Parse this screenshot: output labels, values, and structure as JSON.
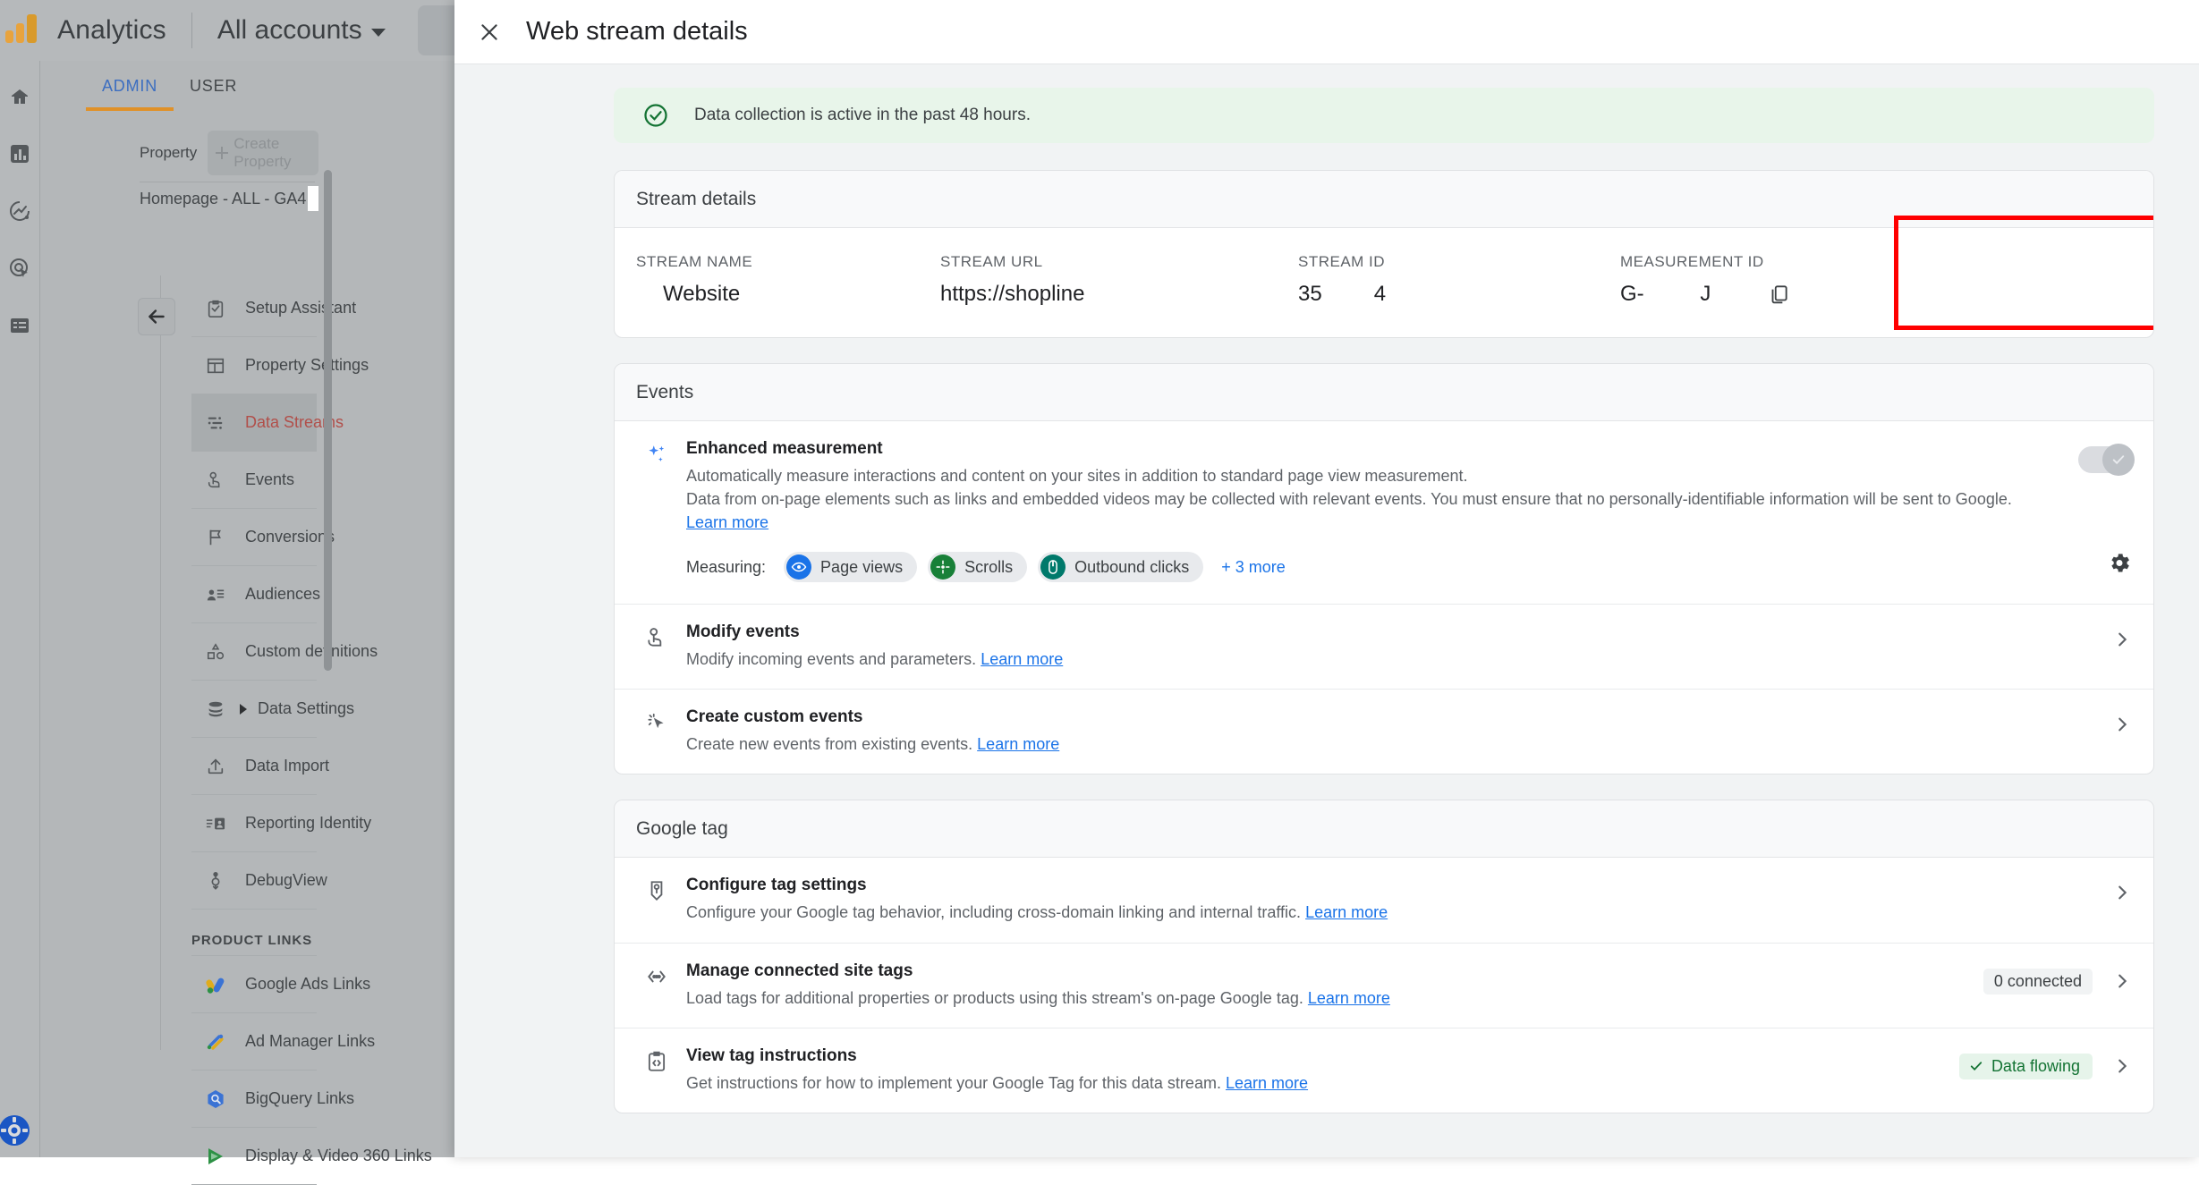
{
  "topbar": {
    "product_name": "Analytics",
    "account_selector": "All accounts",
    "search_icon": "search-icon"
  },
  "rail": {
    "icons": [
      "home-icon",
      "reports-bar-chart-icon",
      "explore-trend-icon",
      "advertising-target-icon",
      "configure-list-icon",
      "gear-icon"
    ]
  },
  "admin": {
    "tabs": [
      {
        "label": "ADMIN",
        "active": true
      },
      {
        "label": "USER",
        "active": false
      }
    ],
    "property_label": "Property",
    "create_property_label": "Create Property",
    "property_name": "Homepage - ALL - GA4",
    "collapse_icon": "arrow-left-icon",
    "nav_items": [
      {
        "label": "Setup Assistant",
        "icon": "clipboard-check-icon",
        "selected": false,
        "expandable": false
      },
      {
        "label": "Property Settings",
        "icon": "layout-panel-icon",
        "selected": false,
        "expandable": false
      },
      {
        "label": "Data Streams",
        "icon": "data-streams-icon",
        "selected": true,
        "expandable": false
      },
      {
        "label": "Events",
        "icon": "tap-hand-icon",
        "selected": false,
        "expandable": false
      },
      {
        "label": "Conversions",
        "icon": "flag-icon",
        "selected": false,
        "expandable": false
      },
      {
        "label": "Audiences",
        "icon": "audiences-person-list-icon",
        "selected": false,
        "expandable": false
      },
      {
        "label": "Custom definitions",
        "icon": "shapes-icon",
        "selected": false,
        "expandable": false
      },
      {
        "label": "Data Settings",
        "icon": "database-icon",
        "selected": false,
        "expandable": true
      },
      {
        "label": "Data Import",
        "icon": "upload-icon",
        "selected": false,
        "expandable": false
      },
      {
        "label": "Reporting Identity",
        "icon": "reporting-identity-badge-icon",
        "selected": false,
        "expandable": false
      },
      {
        "label": "DebugView",
        "icon": "debug-probe-icon",
        "selected": false,
        "expandable": false
      }
    ],
    "product_links_header": "PRODUCT LINKS",
    "product_links": [
      {
        "label": "Google Ads Links",
        "icon": "google-ads-icon"
      },
      {
        "label": "Ad Manager Links",
        "icon": "ad-manager-icon"
      },
      {
        "label": "BigQuery Links",
        "icon": "bigquery-icon"
      },
      {
        "label": "Display & Video 360 Links",
        "icon": "display-video-360-icon"
      }
    ]
  },
  "panel": {
    "title": "Web stream details",
    "close_icon": "close-icon",
    "status_banner": {
      "icon": "check-circle-icon",
      "text": "Data collection is active in the past 48 hours.",
      "background": "#e8f5ea",
      "icon_color": "#137333"
    },
    "stream_details": {
      "card_title": "Stream details",
      "fields": [
        {
          "label": "STREAM NAME",
          "value": "Website"
        },
        {
          "label": "STREAM URL",
          "value": "https://shopline"
        },
        {
          "label": "STREAM ID",
          "value_start": "35",
          "value_end": "4"
        },
        {
          "label": "MEASUREMENT ID",
          "value_start": "G-",
          "value_end": "J",
          "copy_icon": "copy-icon",
          "highlight_color": "#ff0000"
        }
      ]
    },
    "events": {
      "card_title": "Events",
      "enhanced_measurement": {
        "icon": "sparkle-icon",
        "title": "Enhanced measurement",
        "desc_line1": "Automatically measure interactions and content on your sites in addition to standard page view measurement.",
        "desc_line2": "Data from on-page elements such as links and embedded videos may be collected with relevant events. You must ensure that no personally-identifiable information will be sent to Google.",
        "learn_more": "Learn more",
        "toggle_on": true,
        "toggle_disabled": true,
        "measuring_label": "Measuring:",
        "chips": [
          {
            "label": "Page views",
            "icon": "eye-icon",
            "color": "#1a73e8"
          },
          {
            "label": "Scrolls",
            "icon": "scroll-diamond-icon",
            "color": "#188038"
          },
          {
            "label": "Outbound clicks",
            "icon": "mouse-icon",
            "color": "#00796b"
          }
        ],
        "more_label": "+ 3 more",
        "settings_icon": "gear-icon"
      },
      "rows": [
        {
          "icon": "tap-hand-icon",
          "title": "Modify events",
          "desc": "Modify incoming events and parameters.",
          "learn_more": "Learn more",
          "badge": "",
          "chevron": "chevron-right-icon"
        },
        {
          "icon": "custom-event-cursor-icon",
          "title": "Create custom events",
          "desc": "Create new events from existing events.",
          "learn_more": "Learn more",
          "badge": "",
          "chevron": "chevron-right-icon"
        }
      ]
    },
    "google_tag": {
      "card_title": "Google tag",
      "rows": [
        {
          "icon": "tag-icon",
          "title": "Configure tag settings",
          "desc": "Configure your Google tag behavior, including cross-domain linking and internal traffic.",
          "learn_more": "Learn more",
          "badge": "",
          "badge_type": "none",
          "chevron": "chevron-right-icon"
        },
        {
          "icon": "connected-tags-icon",
          "title": "Manage connected site tags",
          "desc": "Load tags for additional properties or products using this stream's on-page Google tag.",
          "learn_more": "Learn more",
          "badge": "0 connected",
          "badge_type": "plain",
          "chevron": "chevron-right-icon"
        },
        {
          "icon": "tag-instructions-icon",
          "title": "View tag instructions",
          "desc": "Get instructions for how to implement your Google Tag for this data stream.",
          "learn_more": "Learn more",
          "badge": "Data flowing",
          "badge_type": "green",
          "badge_icon": "check-icon",
          "chevron": "chevron-right-icon"
        }
      ]
    }
  }
}
